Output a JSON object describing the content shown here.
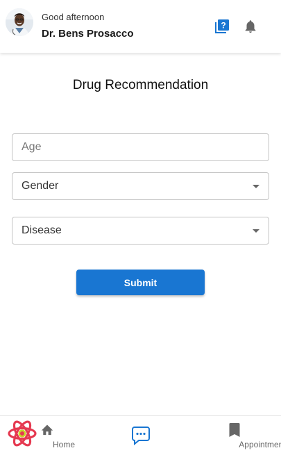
{
  "header": {
    "greeting": "Good afternoon",
    "doctor_name": "Dr. Bens Prosacco",
    "help_icon": "question-book-icon",
    "bell_icon": "bell-icon"
  },
  "main": {
    "title": "Drug Recommendation",
    "age": {
      "placeholder": "Age",
      "value": ""
    },
    "gender": {
      "selected": "Gender"
    },
    "disease": {
      "selected": "Disease"
    },
    "submit_label": "Submit"
  },
  "bottom_nav": {
    "home_label": "Home",
    "chat_icon": "chat-icon",
    "appointments_label": "Appointments"
  },
  "colors": {
    "accent": "#1976d2",
    "icon_gray": "#666666",
    "react_logo": "#e53950"
  }
}
